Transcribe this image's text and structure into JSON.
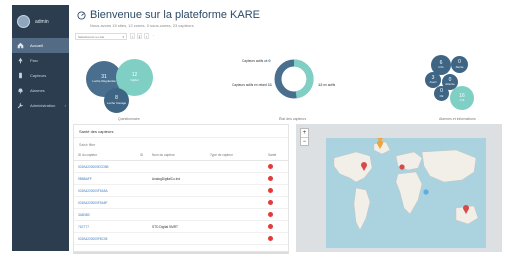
{
  "sidebar": {
    "user": "admin",
    "items": [
      {
        "label": "Accueil",
        "icon": "home-icon",
        "active": true
      },
      {
        "label": "Parc",
        "icon": "tree-icon"
      },
      {
        "label": "Capteurs",
        "icon": "sensor-icon"
      },
      {
        "label": "Alarmes",
        "icon": "bell-icon"
      },
      {
        "label": "Administration",
        "icon": "wrench-icon",
        "chevron": "‹"
      }
    ]
  },
  "header": {
    "title": "Bienvenue sur la plateforme KARE",
    "subtitle": "Nous avons 15 sites, 12 zones, 0 sous-zones, 23 capteurs"
  },
  "filter": {
    "placeholder": "Sélectionner un site",
    "caret": "▾"
  },
  "pager": {
    "prev": "‹",
    "page": "1",
    "next": "›",
    "sep": "·"
  },
  "charts": {
    "left": {
      "caption": "Questionnaire",
      "bubbles": [
        {
          "value": "31",
          "label": "Loche Régularisé",
          "color": "#4a6e8d"
        },
        {
          "value": "12",
          "label": "Vigilior",
          "color": "#7fcfc4"
        },
        {
          "value": "8",
          "label": "Loche Vonage",
          "color": "#3f6584"
        }
      ]
    },
    "middle": {
      "caption": "État des capteurs",
      "active_label": "Capteurs actifs ok",
      "active_value": "0",
      "late_label": "Capteurs actifs en retard",
      "late_value": "11",
      "inactive_label": "en actifs",
      "inactive_value": "12"
    },
    "right": {
      "caption": "Alarmes et informations",
      "bubbles": [
        {
          "value": "6",
          "label": "Info",
          "color": "#3f6584"
        },
        {
          "value": "0",
          "label": "Alerte",
          "color": "#3f6584"
        },
        {
          "value": "3",
          "label": "Avert",
          "color": "#3f6584"
        },
        {
          "value": "0",
          "label": "Attente",
          "color": "#3f6584"
        },
        {
          "value": "0",
          "label": "Ok",
          "color": "#3f6584"
        },
        {
          "value": "16",
          "label": "Crit",
          "color": "#7fcfc4"
        }
      ]
    }
  },
  "sensors": {
    "title": "Santé des capteurs",
    "filter_label": "Saisir filtre",
    "columns": [
      "ID du capteur",
      "ID",
      "Nom du capteur",
      "Type de capteur",
      "Santé"
    ],
    "rows": [
      {
        "id": "001B4220000ECD5B",
        "name": ""
      },
      {
        "id": "9B8BAFF",
        "name": "AnalogDigitalCo.ind"
      },
      {
        "id": "001B4220000F5A5A",
        "name": ""
      },
      {
        "id": "001B4220000F5A5F",
        "name": ""
      },
      {
        "id": "3AB3B0",
        "name": ""
      },
      {
        "id": "71E777",
        "name": "STD Digital SMRT"
      },
      {
        "id": "001B4220000F8C05",
        "name": ""
      }
    ]
  },
  "map": {
    "zoom_in": "+",
    "zoom_out": "−"
  },
  "colors": {
    "sidebar": "#2b3d4f",
    "accent": "#4a6e8d",
    "teal": "#7fcfc4",
    "alarm": "#e23b3b"
  }
}
